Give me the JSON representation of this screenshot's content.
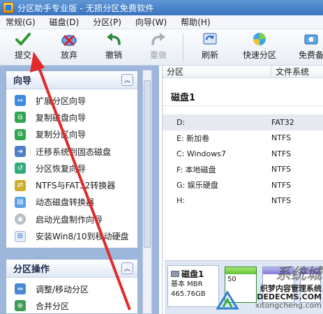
{
  "window": {
    "title": "分区助手专业版 - 无损分区免费软件"
  },
  "menu": [
    "常规(G)",
    "磁盘(D)",
    "分区(P)",
    "向导(W)",
    "帮助(H)"
  ],
  "toolbar": {
    "items": [
      {
        "label": "提交",
        "icon": "check-icon",
        "enabled": true
      },
      {
        "label": "放弃",
        "icon": "discard-icon",
        "enabled": true
      },
      {
        "label": "撤销",
        "icon": "undo-icon",
        "enabled": true
      },
      {
        "label": "重做",
        "icon": "redo-icon",
        "enabled": false
      },
      {
        "label": "刷新",
        "icon": "refresh-icon",
        "enabled": true
      },
      {
        "label": "快速分区",
        "icon": "quick-partition-icon",
        "enabled": true
      },
      {
        "label": "免费备",
        "icon": "backup-icon",
        "enabled": true
      }
    ]
  },
  "wizard": {
    "title": "向导",
    "items": [
      {
        "label": "扩展分区向导",
        "icon": "expand-partition-icon"
      },
      {
        "label": "复制磁盘向导",
        "icon": "copy-disk-icon"
      },
      {
        "label": "复制分区向导",
        "icon": "copy-partition-icon"
      },
      {
        "label": "迁移系统到固态磁盘",
        "icon": "migrate-os-icon"
      },
      {
        "label": "分区恢复向导",
        "icon": "partition-recovery-icon"
      },
      {
        "label": "NTFS与FAT32转换器",
        "icon": "convert-icon"
      },
      {
        "label": "动态磁盘转换器",
        "icon": "dynamic-disk-icon"
      },
      {
        "label": "启动光盘制作向导",
        "icon": "boot-cd-icon"
      },
      {
        "label": "安装Win8/10到移动硬盘",
        "icon": "windows-icon"
      }
    ]
  },
  "partition_ops": {
    "title": "分区操作",
    "items": [
      {
        "label": "调整/移动分区",
        "icon": "resize-partition-icon"
      },
      {
        "label": "合并分区",
        "icon": "merge-partition-icon"
      }
    ]
  },
  "list": {
    "columns": [
      "分区",
      "文件系统"
    ],
    "disk_label": "磁盘1",
    "rows": [
      {
        "name": "D:",
        "fs": "FAT32",
        "selected": true
      },
      {
        "name": "E: 新加卷",
        "fs": "NTFS",
        "selected": false
      },
      {
        "name": "C: Windows7",
        "fs": "NTFS",
        "selected": false
      },
      {
        "name": "F: 本地磁盘",
        "fs": "NTFS",
        "selected": false
      },
      {
        "name": "G: 娱乐硬盘",
        "fs": "NTFS",
        "selected": false
      },
      {
        "name": "H:",
        "fs": "NTFS",
        "selected": false
      }
    ]
  },
  "disk_map": {
    "name": "磁盘1",
    "type": "基本 MBR",
    "size": "465.76GB",
    "first_partition_size": "50"
  },
  "watermark": {
    "big": "系统城",
    "line1": "织梦内容管理系统",
    "line2": "DEDECMS.COM",
    "line3": "xitongcheng.com"
  }
}
